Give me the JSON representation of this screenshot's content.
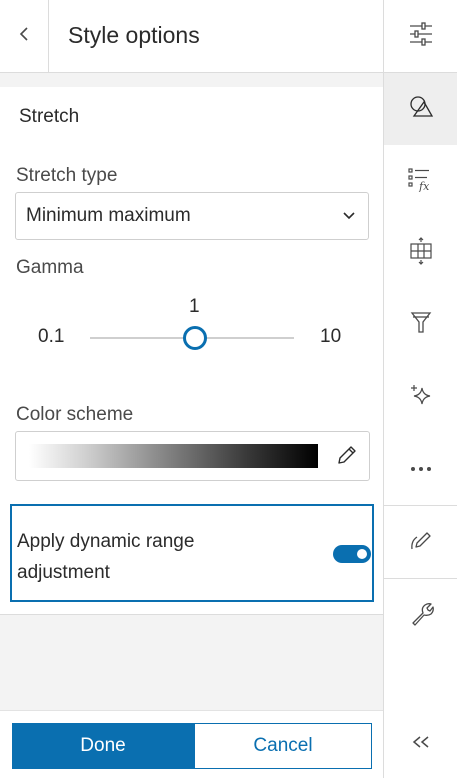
{
  "header": {
    "title": "Style options"
  },
  "stretch": {
    "section_title": "Stretch",
    "stretch_type_label": "Stretch type",
    "stretch_type_value": "Minimum maximum",
    "gamma_label": "Gamma",
    "gamma_value": "1",
    "gamma_min": "0.1",
    "gamma_max": "10",
    "gamma_position_fraction": 0.45,
    "color_scheme_label": "Color scheme",
    "dynamic_range_label": "Apply dynamic range adjustment",
    "dynamic_range_enabled": true
  },
  "footer": {
    "done_label": "Done",
    "cancel_label": "Cancel"
  },
  "rail": {
    "icons": [
      "sliders-icon",
      "shapes-icon",
      "list-fx-icon",
      "grid-resize-icon",
      "funnel-icon",
      "sparkle-icon",
      "more-icon",
      "pen-icon",
      "wrench-icon",
      "collapse-double-chevron-icon"
    ],
    "active": "shapes-icon"
  },
  "colors": {
    "accent": "#0a6fb0",
    "panel_bg": "#f3f3f3",
    "border": "#dcdcdc"
  }
}
